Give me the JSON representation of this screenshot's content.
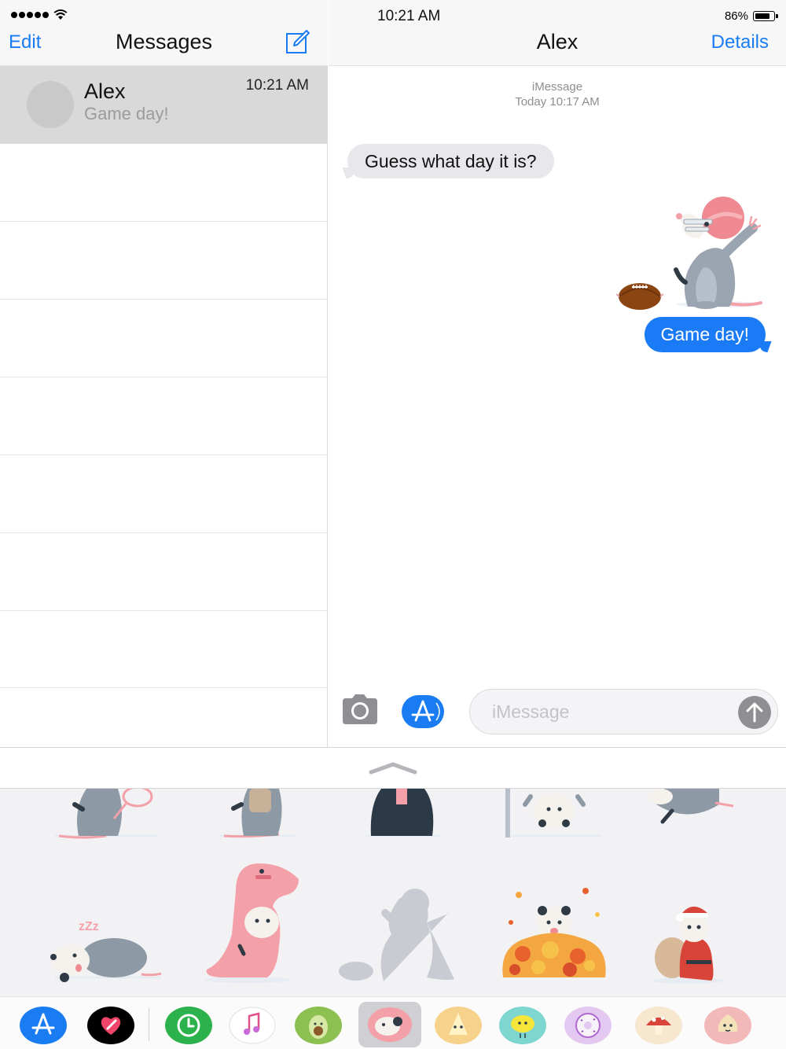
{
  "status_bar": {
    "time": "10:21 AM",
    "battery_percent": "86%",
    "battery_level": 0.86
  },
  "left": {
    "edit_label": "Edit",
    "title": "Messages",
    "conversations": [
      {
        "name": "Alex",
        "preview": "Game day!",
        "time": "10:21 AM"
      }
    ]
  },
  "chat": {
    "title": "Alex",
    "details_label": "Details",
    "service": "iMessage",
    "timestamp": "Today 10:17 AM",
    "messages": [
      {
        "direction": "incoming",
        "text": "Guess what day it is?"
      },
      {
        "direction": "outgoing",
        "sticker": "football-opossum-sticker"
      },
      {
        "direction": "outgoing",
        "text": "Game day!"
      }
    ],
    "input_placeholder": "iMessage"
  },
  "colors": {
    "accent": "#1a7cf3",
    "outgoing_bubble": "#1b7bf6",
    "incoming_bubble": "#e8e8ec",
    "selected_row": "#d9d9d9"
  },
  "drawer": {
    "stickers_row1": [
      "tennis-opossum",
      "backpack-opossum",
      "suit-opossum",
      "hanging-opossum",
      "flying-opossum"
    ],
    "stickers_row2": [
      "sleeping-opossum",
      "dinosaur-costume-opossum",
      "silhouette-opossum",
      "leaf-pile-opossum",
      "santa-opossum"
    ],
    "apps": [
      "app-store",
      "digital-touch",
      "clock-app",
      "music",
      "avocado-stickers",
      "opossum-stickers",
      "cheese-stickers",
      "lemon-stickers",
      "donut-stickers",
      "mushroom-stickers",
      "onion-stickers"
    ]
  }
}
